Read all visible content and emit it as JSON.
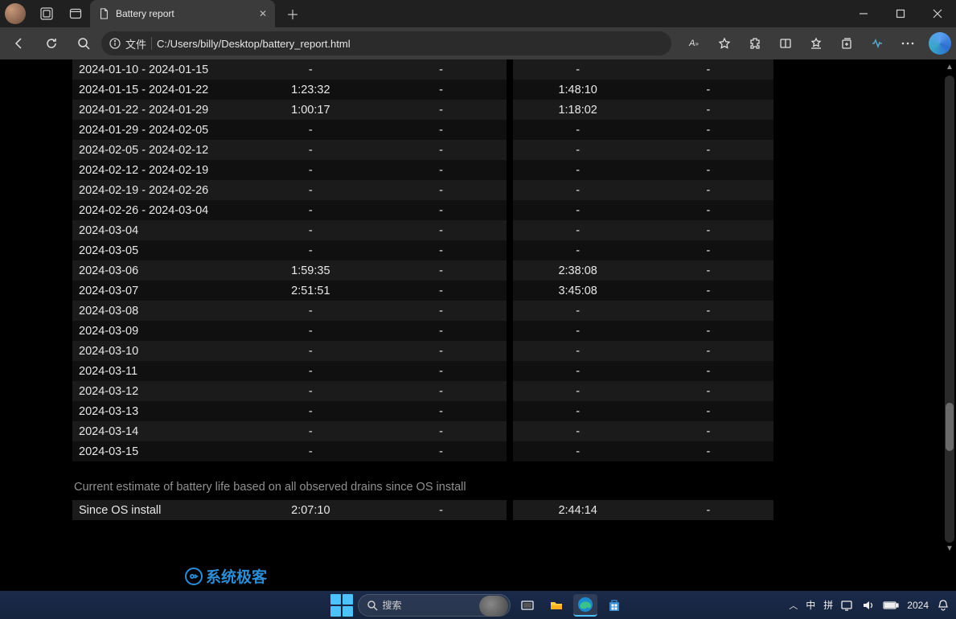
{
  "window": {
    "tab_title": "Battery report",
    "url_label": "文件",
    "url": "C:/Users/billy/Desktop/battery_report.html"
  },
  "table_rows": [
    {
      "period": "2024-01-10 - 2024-01-15",
      "a": "-",
      "b": "-",
      "c": "-",
      "d": "-"
    },
    {
      "period": "2024-01-15 - 2024-01-22",
      "a": "1:23:32",
      "b": "-",
      "c": "1:48:10",
      "d": "-"
    },
    {
      "period": "2024-01-22 - 2024-01-29",
      "a": "1:00:17",
      "b": "-",
      "c": "1:18:02",
      "d": "-"
    },
    {
      "period": "2024-01-29 - 2024-02-05",
      "a": "-",
      "b": "-",
      "c": "-",
      "d": "-"
    },
    {
      "period": "2024-02-05 - 2024-02-12",
      "a": "-",
      "b": "-",
      "c": "-",
      "d": "-"
    },
    {
      "period": "2024-02-12 - 2024-02-19",
      "a": "-",
      "b": "-",
      "c": "-",
      "d": "-"
    },
    {
      "period": "2024-02-19 - 2024-02-26",
      "a": "-",
      "b": "-",
      "c": "-",
      "d": "-"
    },
    {
      "period": "2024-02-26 - 2024-03-04",
      "a": "-",
      "b": "-",
      "c": "-",
      "d": "-"
    },
    {
      "period": "2024-03-04",
      "a": "-",
      "b": "-",
      "c": "-",
      "d": "-"
    },
    {
      "period": "2024-03-05",
      "a": "-",
      "b": "-",
      "c": "-",
      "d": "-"
    },
    {
      "period": "2024-03-06",
      "a": "1:59:35",
      "b": "-",
      "c": "2:38:08",
      "d": "-"
    },
    {
      "period": "2024-03-07",
      "a": "2:51:51",
      "b": "-",
      "c": "3:45:08",
      "d": "-"
    },
    {
      "period": "2024-03-08",
      "a": "-",
      "b": "-",
      "c": "-",
      "d": "-"
    },
    {
      "period": "2024-03-09",
      "a": "-",
      "b": "-",
      "c": "-",
      "d": "-"
    },
    {
      "period": "2024-03-10",
      "a": "-",
      "b": "-",
      "c": "-",
      "d": "-"
    },
    {
      "period": "2024-03-11",
      "a": "-",
      "b": "-",
      "c": "-",
      "d": "-"
    },
    {
      "period": "2024-03-12",
      "a": "-",
      "b": "-",
      "c": "-",
      "d": "-"
    },
    {
      "period": "2024-03-13",
      "a": "-",
      "b": "-",
      "c": "-",
      "d": "-"
    },
    {
      "period": "2024-03-14",
      "a": "-",
      "b": "-",
      "c": "-",
      "d": "-"
    },
    {
      "period": "2024-03-15",
      "a": "-",
      "b": "-",
      "c": "-",
      "d": "-"
    }
  ],
  "summary_note": "Current estimate of battery life based on all observed drains since OS install",
  "summary_row": {
    "period": "Since OS install",
    "a": "2:07:10",
    "b": "-",
    "c": "2:44:14",
    "d": "-"
  },
  "watermark": "系统极客",
  "taskbar": {
    "search_placeholder": "搜索",
    "ime_lang": "中",
    "ime_mode": "拼",
    "year": "2024"
  }
}
